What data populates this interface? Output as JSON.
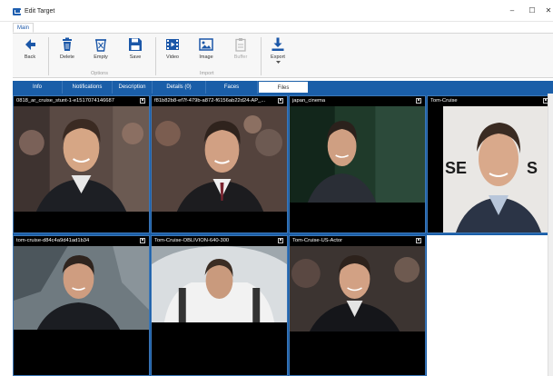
{
  "window": {
    "title": "Edit Target",
    "minimize": "–",
    "maximize": "☐",
    "close": "✕"
  },
  "ribbon": {
    "tab": "Main",
    "buttons": {
      "back": "Back",
      "delete": "Delete",
      "empty": "Empty",
      "save": "Save",
      "video": "Video",
      "image": "Image",
      "buffer": "Buffer",
      "export": "Export"
    },
    "groups": {
      "options": "Options",
      "import": "Import"
    }
  },
  "tabs": [
    "Info",
    "Notifications",
    "Description",
    "Details (0)",
    "Faces",
    "Files"
  ],
  "active_tab": "Files",
  "files": [
    "0818_ar_cruise_stunt-1-e1517074146687",
    "f81b82b8-ef7f-479b-a872-f6156ab22d24-AP_...",
    "japan_cinema",
    "Tom-Cruise",
    "tom-cruise-d84c4a9d41ad1b34",
    "Tom-Cruise-OBLIVION-640-300",
    "Tom-Cruise-US-Actor"
  ],
  "colors": {
    "accent": "#1a5ea8",
    "card_bg": "#000000"
  }
}
